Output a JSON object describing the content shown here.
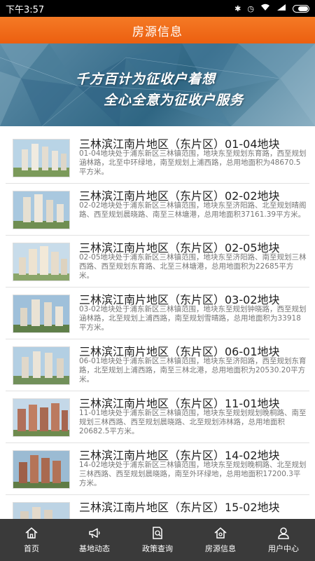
{
  "status_bar": {
    "time": "下午3:57",
    "icons": [
      "bluetooth-icon",
      "alarm-icon",
      "wifi-icon",
      "signal-icon",
      "battery-icon"
    ]
  },
  "header": {
    "title": "房源信息"
  },
  "banner": {
    "line1": "千方百计为征收户着想",
    "line2": "全心全意为征收户服务"
  },
  "listings": [
    {
      "title": "三林滨江南片地区（东片区）01-04地块",
      "desc": "01-04地块处于浦东新区三林镇范围，地块东至规划东育路，西至规划涵林路，北至中环绿地，南至规划上浦西路，总用地面积为48670.5平方米。"
    },
    {
      "title": "三林滨江南片地区（东片区）02-02地块",
      "desc": "02-02地块处于浦东新区三林镇范围，地块东至济阳路、北至规划晴阁路、西至规划晨晓路、南至三林塘港，总用地面积37161.39平方米。"
    },
    {
      "title": "三林滨江南片地区（东片区）02-05地块",
      "desc": "02-05地块处于浦东新区三林镇范围，地块东至济阳路、南至规划三林西路、西至规划东育路、北至三林塘港，总用地面积为22685平方米。"
    },
    {
      "title": "三林滨江南片地区（东片区）03-02地块",
      "desc": "03-02地块处于浦东新区三林镇范围，地块东至规划钟晓路，西至规划涵林路，北至规划上浦西路，南至规划雪晴路，总用地面积为33918平方米。"
    },
    {
      "title": "三林滨江南片地区（东片区）06-01地块",
      "desc": "06-01地块处于浦东新区三林镇范围，地块东至济阳路，西至规划东育路，北至规划上浦西路，南至三林北港，总用地面积为20530.20平方米。"
    },
    {
      "title": "三林滨江南片地区（东片区）11-01地块",
      "desc": "11-01地块处于浦东新区三林镇范围，地块东至规划规划晚桐路、南至规划三林西路、西至规划晨晓路、北至规划沛林路，总用地面积20682.5平方米。"
    },
    {
      "title": "三林滨江南片地区（东片区）14-02地块",
      "desc": "14-02地块处于浦东新区三林镇范围，地块东至规划晚桐路、北至规划三林西路、西至规划晨晓路，南至外环绿地，总用地面积17200.3平方米。"
    },
    {
      "title": "三林滨江南片地区（东片区）15-02地块",
      "desc": ""
    }
  ],
  "bottom_nav": [
    {
      "label": "首页",
      "icon": "home-icon"
    },
    {
      "label": "基地动态",
      "icon": "megaphone-icon"
    },
    {
      "label": "政策查询",
      "icon": "policy-search-icon"
    },
    {
      "label": "房源信息",
      "icon": "house-icon"
    },
    {
      "label": "用户中心",
      "icon": "user-icon"
    }
  ],
  "colors": {
    "accent": "#f26d1a",
    "nav_bg": "#3a3a3a",
    "banner": "#3f7390"
  }
}
